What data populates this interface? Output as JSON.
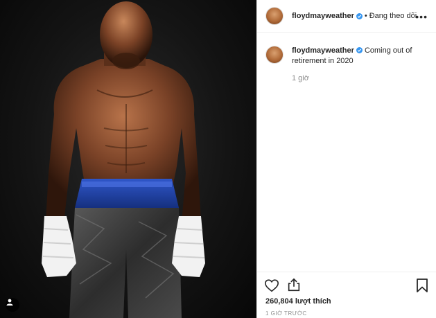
{
  "post": {
    "author": "floydmayweather",
    "follow_dot": "•",
    "follow_status": "Đang theo dõi",
    "more_label": "•••",
    "caption": "Coming out of retirement in 2020",
    "time_ago": "1 giờ",
    "likes": "260,804 lượt thích",
    "timestamp": "1 GIỜ TRƯỚC"
  },
  "icons": {
    "verified": "verified-badge-icon",
    "like": "heart-icon",
    "share": "share-icon",
    "save": "bookmark-icon",
    "more": "more-options-icon",
    "user_tag": "person-icon"
  },
  "colors": {
    "verified_blue": "#3897f0",
    "text_primary": "#262626",
    "text_secondary": "#8e8e8e",
    "divider": "#efefef"
  }
}
